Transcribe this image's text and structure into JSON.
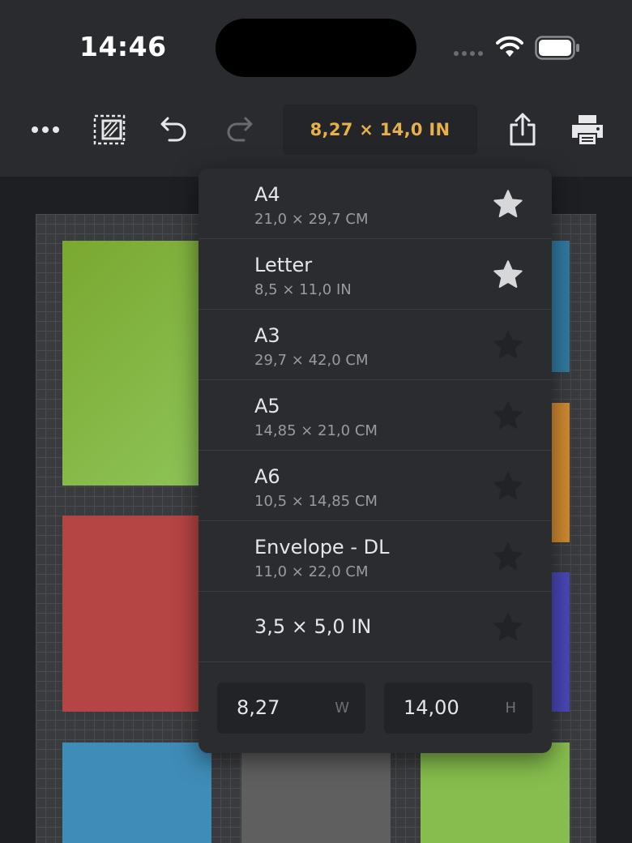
{
  "status": {
    "time": "14:46"
  },
  "toolbar": {
    "more_icon": "ellipsis-icon",
    "size_label": "8,27 × 14,0 IN"
  },
  "colors": {
    "accent": "#e6b14a",
    "green": "#86bd4e",
    "red": "#b44444",
    "blue": "#3f8cb8",
    "orange": "#d08a32",
    "indigo": "#4a47b8",
    "gray": "#5f5f60"
  },
  "dropdown": {
    "items": [
      {
        "name": "A4",
        "sub": "21,0 × 29,7 CM",
        "favorite": true
      },
      {
        "name": "Letter",
        "sub": "8,5 × 11,0 IN",
        "favorite": true
      },
      {
        "name": "A3",
        "sub": "29,7 × 42,0 CM",
        "favorite": false
      },
      {
        "name": "A5",
        "sub": "14,85 × 21,0 CM",
        "favorite": false
      },
      {
        "name": "A6",
        "sub": "10,5 × 14,85 CM",
        "favorite": false
      },
      {
        "name": "Envelope - DL",
        "sub": "11,0 × 22,0 CM",
        "favorite": false
      },
      {
        "name": "3,5 × 5,0 IN",
        "sub": "",
        "favorite": false
      }
    ],
    "width": {
      "value": "8,27",
      "unit": "W"
    },
    "height": {
      "value": "14,00",
      "unit": "H"
    }
  }
}
